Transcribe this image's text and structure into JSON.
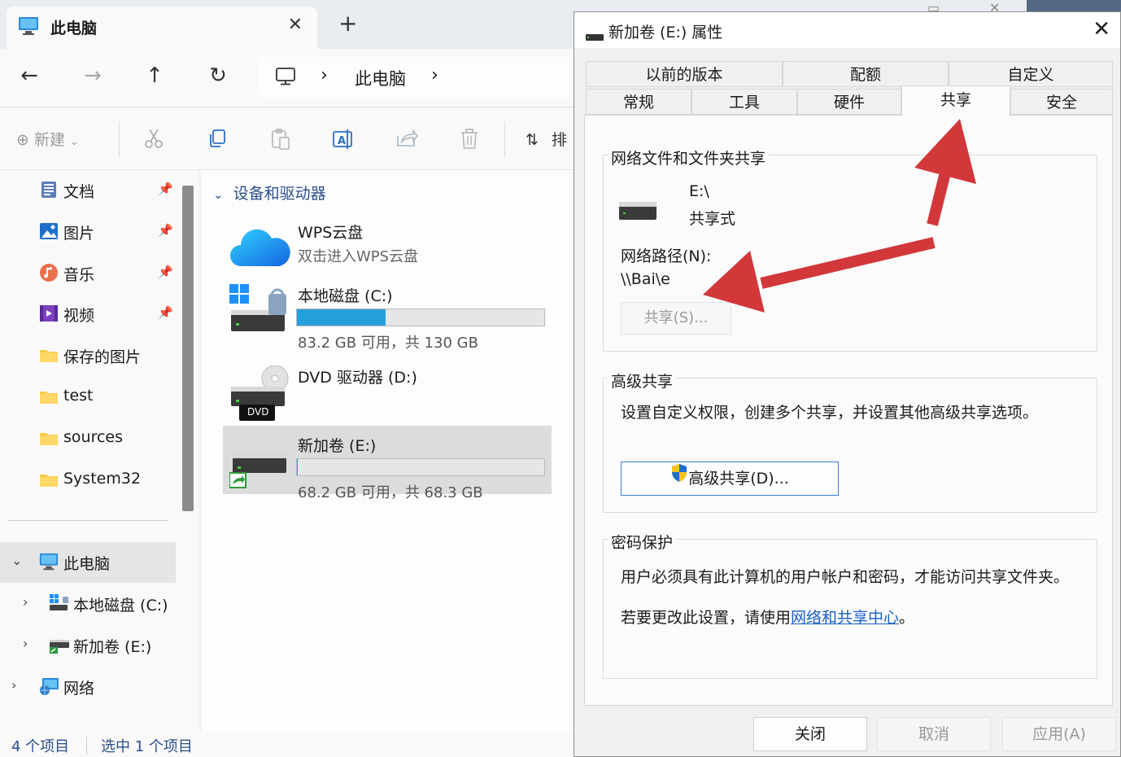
{
  "explorer": {
    "tab_title": "此电脑",
    "tab_close": "✕",
    "tab_add": "+",
    "nav": {
      "back": "←",
      "forward": "→",
      "up": "↑",
      "refresh": "↻"
    },
    "address": {
      "separator": "›",
      "crumb": "此电脑"
    },
    "toolbar": {
      "new_label": "新建",
      "sort_label": "排"
    },
    "sidebar": {
      "quick": [
        {
          "label": "文档",
          "icon": "document-icon"
        },
        {
          "label": "图片",
          "icon": "pictures-icon"
        },
        {
          "label": "音乐",
          "icon": "music-icon"
        },
        {
          "label": "视频",
          "icon": "video-icon"
        },
        {
          "label": "保存的图片",
          "icon": "folder-icon"
        },
        {
          "label": "test",
          "icon": "folder-icon"
        },
        {
          "label": "sources",
          "icon": "folder-icon"
        },
        {
          "label": "System32",
          "icon": "folder-icon"
        }
      ],
      "this_pc": "此电脑",
      "drive_c": "本地磁盘 (C:)",
      "drive_e": "新加卷 (E:)",
      "network": "网络"
    },
    "group_title": "设备和驱动器",
    "drives": {
      "wps": {
        "name": "WPS云盘",
        "sub": "双击进入WPS云盘"
      },
      "c": {
        "name": "本地磁盘 (C:)",
        "free": "83.2 GB 可用，共 130 GB",
        "used_fraction": 0.36
      },
      "d": {
        "name": "DVD 驱动器 (D:)",
        "badge": "DVD"
      },
      "e": {
        "name": "新加卷 (E:)",
        "free": "68.2 GB 可用，共 68.3 GB",
        "used_fraction": 0.0015
      }
    },
    "status": {
      "items": "4 个项目",
      "selected": "选中 1 个项目"
    }
  },
  "dialog": {
    "title": "新加卷 (E:) 属性",
    "close": "✕",
    "tabs_top": [
      "以前的版本",
      "配额",
      "自定义"
    ],
    "tabs_bottom": [
      "常规",
      "工具",
      "硬件",
      "共享",
      "安全"
    ],
    "active_tab": "共享",
    "network_share": {
      "group": "网络文件和文件夹共享",
      "path": "E:\\",
      "state": "共享式",
      "net_path_label": "网络路径(N):",
      "net_path": "\\\\Bai\\e",
      "share_button": "共享(S)..."
    },
    "advanced": {
      "group": "高级共享",
      "desc": "设置自定义权限，创建多个共享，并设置其他高级共享选项。",
      "button": "高级共享(D)..."
    },
    "password": {
      "group": "密码保护",
      "desc": "用户必须具有此计算机的用户帐户和密码，才能访问共享文件夹。",
      "change_prefix": "若要更改此设置，请使用",
      "link": "网络和共享中心",
      "change_suffix": "。"
    },
    "buttons": {
      "close": "关闭",
      "cancel": "取消",
      "apply": "应用(A)"
    }
  },
  "colors": {
    "accent": "#26a0da",
    "annotation_arrow": "#d2373a",
    "link": "#1a5fc8"
  }
}
